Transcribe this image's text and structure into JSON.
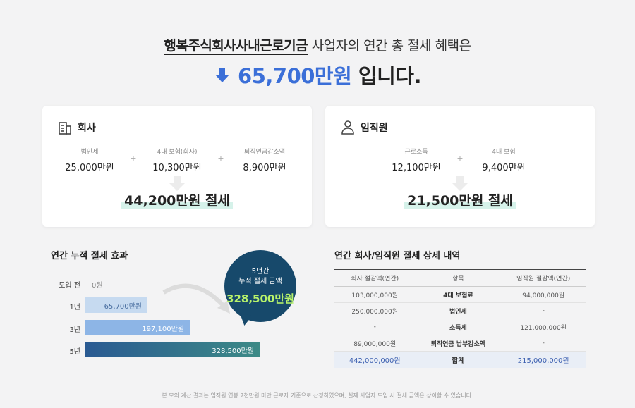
{
  "headline": {
    "company": "행복주식회사사내근로기금",
    "line1_rest": "사업자의 연간 총 절세 혜택은",
    "amount": "65,700만원",
    "suffix": "입니다."
  },
  "company_card": {
    "title": "회사",
    "items": [
      {
        "label": "법인세",
        "value": "25,000만원"
      },
      {
        "label": "4대 보험(회사)",
        "value": "10,300만원"
      },
      {
        "label": "퇴직연금감소액",
        "value": "8,900만원"
      }
    ],
    "total": "44,200만원 절세"
  },
  "employee_card": {
    "title": "임직원",
    "items": [
      {
        "label": "근로소득",
        "value": "12,100만원"
      },
      {
        "label": "4대 보험",
        "value": "9,400만원"
      }
    ],
    "total": "21,500만원 절세"
  },
  "cumulative": {
    "title": "연간 누적 절세 효과",
    "bubble": {
      "line1": "5년간",
      "line2": "누적 절세 금액",
      "amount": "328,500만원"
    }
  },
  "chart_data": {
    "type": "bar",
    "orientation": "horizontal",
    "title": "연간 누적 절세 효과",
    "categories": [
      "도입 전",
      "1년",
      "3년",
      "5년"
    ],
    "values": [
      0,
      65700,
      197100,
      328500
    ],
    "value_labels": [
      "0원",
      "65,700만원",
      "197,100만원",
      "328,500만원"
    ],
    "unit": "만원",
    "xlim": [
      0,
      328500
    ],
    "colors": [
      "#ffffff",
      "#c6daf0",
      "#8db5e6",
      "#2e6b9a"
    ]
  },
  "detail": {
    "title": "연간 회사/임직원 절세 상세 내역",
    "headers": [
      "회사 절감액(연간)",
      "항목",
      "임직원 절감액(연간)"
    ],
    "rows": [
      [
        "103,000,000원",
        "4대 보험료",
        "94,000,000원"
      ],
      [
        "250,000,000원",
        "법인세",
        "-"
      ],
      [
        "-",
        "소득세",
        "121,000,000원"
      ],
      [
        "89,000,000원",
        "퇴직연금 납부감소액",
        "-"
      ]
    ],
    "sum": [
      "442,000,000원",
      "합계",
      "215,000,000원"
    ]
  },
  "footnote": "본 모의 계산 결과는 임직원 연봉 7천만원 미만 근로자 기준으로 산정하였으며, 실제 사업자 도입 시 절세 금액은 상이할 수 있습니다."
}
